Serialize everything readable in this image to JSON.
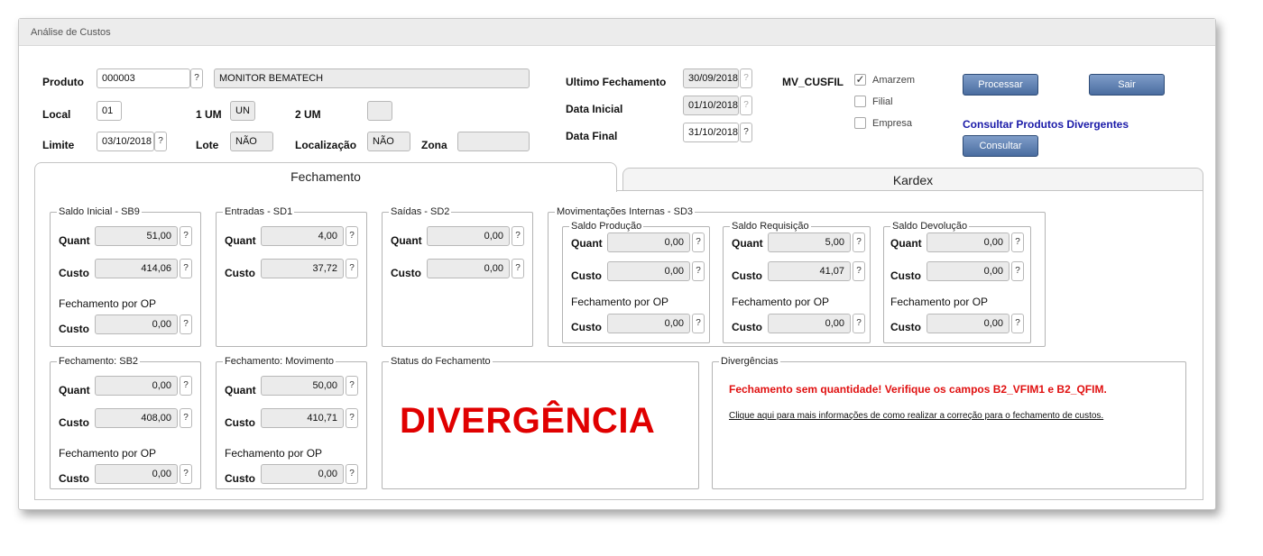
{
  "window": {
    "title": "Análise de Custos"
  },
  "header": {
    "produto": {
      "label": "Produto",
      "code": "000003",
      "description": "MONITOR BEMATECH"
    },
    "local": {
      "label": "Local",
      "value": "01"
    },
    "um1": {
      "label": "1 UM",
      "value": "UN"
    },
    "um2": {
      "label": "2 UM",
      "value": ""
    },
    "limite": {
      "label": "Limite",
      "value": "03/10/2018"
    },
    "lote": {
      "label": "Lote",
      "value": "NÃO"
    },
    "localizacao": {
      "label": "Localização",
      "value": "NÃO"
    },
    "zona": {
      "label": "Zona",
      "value": ""
    },
    "ultimo_fechamento": {
      "label": "Ultimo Fechamento",
      "value": "30/09/2018"
    },
    "data_inicial": {
      "label": "Data Inicial",
      "value": "01/10/2018"
    },
    "data_final": {
      "label": "Data Final",
      "value": "31/10/2018"
    },
    "mv_cusfil": {
      "label": "MV_CUSFIL",
      "options": [
        {
          "label": "Amarzem",
          "checked": true
        },
        {
          "label": "Filial",
          "checked": false
        },
        {
          "label": "Empresa",
          "checked": false
        }
      ]
    },
    "processar_label": "Processar",
    "sair_label": "Sair",
    "consultar_divergentes_label": "Consultar Produtos Divergentes",
    "consultar_label": "Consultar",
    "help_glyph": "?"
  },
  "tabs": [
    {
      "label": "Fechamento",
      "active": true
    },
    {
      "label": "Kardex",
      "active": false
    }
  ],
  "labels": {
    "quant": "Quant",
    "custo": "Custo",
    "fechamento_op": "Fechamento por OP"
  },
  "groups": {
    "saldo_inicial": {
      "title": "Saldo Inicial - SB9",
      "quant": "51,00",
      "custo": "414,06",
      "custo_op": "0,00"
    },
    "entradas": {
      "title": "Entradas - SD1",
      "quant": "4,00",
      "custo": "37,72"
    },
    "saidas": {
      "title": "Saídas - SD2",
      "quant": "0,00",
      "custo": "0,00"
    },
    "mov_internas": {
      "title": "Movimentações Internas - SD3",
      "producao": {
        "title": "Saldo Produção",
        "quant": "0,00",
        "custo": "0,00",
        "custo_op": "0,00"
      },
      "requisicao": {
        "title": "Saldo Requisição",
        "quant": "5,00",
        "custo": "41,07",
        "custo_op": "0,00"
      },
      "devolucao": {
        "title": "Saldo Devolução",
        "quant": "0,00",
        "custo": "0,00",
        "custo_op": "0,00"
      }
    },
    "fechamento_sb2": {
      "title": "Fechamento: SB2",
      "quant": "0,00",
      "custo": "408,00",
      "custo_op": "0,00"
    },
    "fechamento_mov": {
      "title": "Fechamento: Movimento",
      "quant": "50,00",
      "custo": "410,71",
      "custo_op": "0,00"
    },
    "status": {
      "title": "Status do Fechamento",
      "value": "DIVERGÊNCIA",
      "color": "#e00000"
    },
    "divergencias": {
      "title": "Divergências",
      "message": "Fechamento sem quantidade! Verifique os campos B2_VFIM1 e B2_QFIM.",
      "help_link": "Clique aqui para mais informações de como realizar a correção para o fechamento de custos."
    }
  },
  "colors": {
    "button_top": "#7f9dc9",
    "button_bottom": "#4a6da0",
    "link_blue": "#1a1aa8",
    "error_red": "#e01010"
  }
}
